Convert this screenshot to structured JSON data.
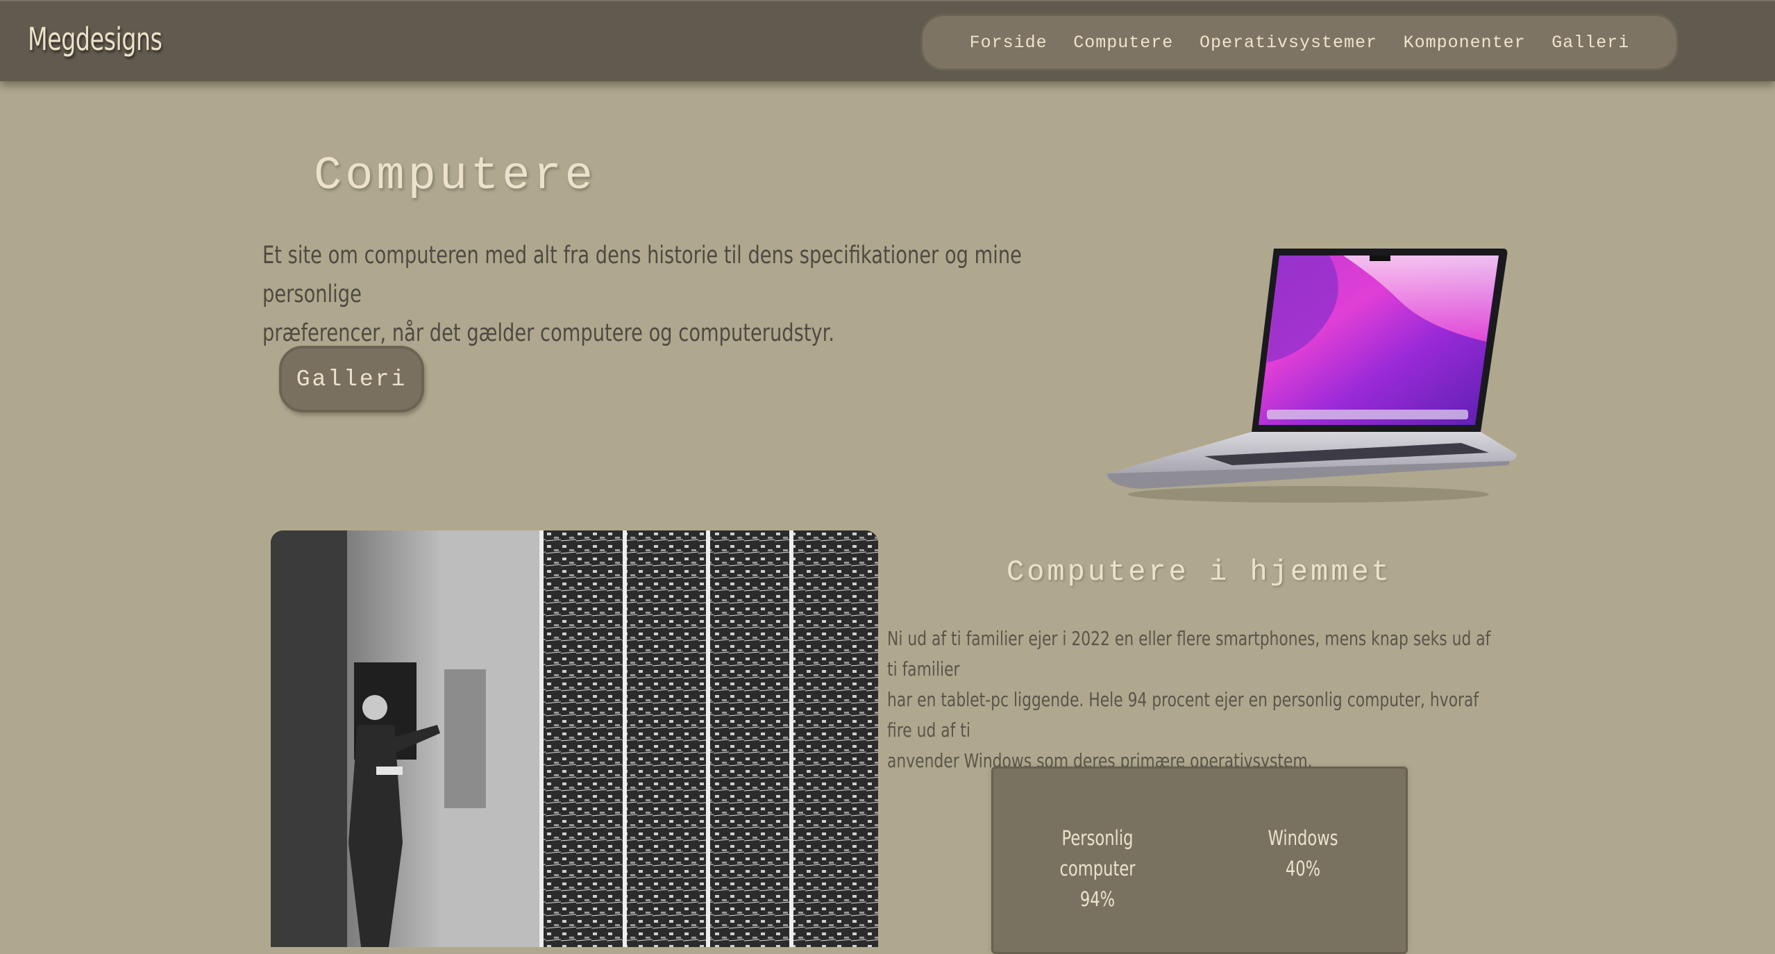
{
  "brand": "Megdesigns",
  "nav": {
    "items": [
      "Forside",
      "Computere",
      "Operativsystemer",
      "Komponenter",
      "Galleri"
    ]
  },
  "hero": {
    "title": "Computere",
    "text_lines": [
      "Et site om computeren med alt fra dens historie til dens specifikationer og mine personlige",
      "præferencer, når det gælder computere og computerudstyr."
    ],
    "button": "Galleri"
  },
  "section": {
    "title": "Computere i hjemmet",
    "text_lines": [
      "Ni ud af ti familier ejer i 2022 en eller flere smartphones, mens knap seks ud af ti familier",
      "har en tablet-pc liggende. Hele 94 procent ejer en personlig computer, hvoraf fire ud af ti",
      "anvender Windows som deres primære operativsystem."
    ]
  },
  "stats": [
    {
      "label_lines": [
        "Personlig",
        "computer"
      ],
      "value": "94%"
    },
    {
      "label_lines": [
        "Windows"
      ],
      "value": "40%"
    }
  ],
  "colors": {
    "background": "#afa88e",
    "header": "#615a4e",
    "nav_pill": "#7d7463",
    "accent_text": "#ece2cb",
    "body_text": "#4e4a42"
  }
}
